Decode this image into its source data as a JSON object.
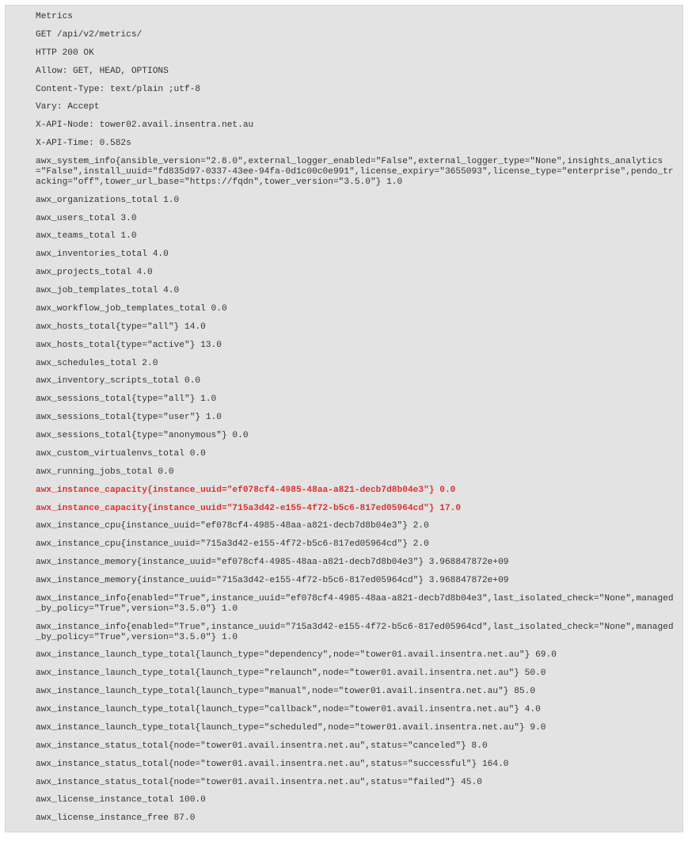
{
  "lines": [
    {
      "text": "Metrics",
      "red": false
    },
    {
      "text": "GET /api/v2/metrics/",
      "red": false
    },
    {
      "text": "HTTP 200 OK",
      "red": false
    },
    {
      "text": "Allow: GET, HEAD, OPTIONS",
      "red": false
    },
    {
      "text": "Content-Type: text/plain ;utf-8",
      "red": false
    },
    {
      "text": "Vary: Accept",
      "red": false
    },
    {
      "text": "X-API-Node: tower02.avail.insentra.net.au",
      "red": false
    },
    {
      "text": "X-API-Time: 0.582s",
      "red": false
    },
    {
      "text": "awx_system_info{ansible_version=\"2.8.0\",external_logger_enabled=\"False\",external_logger_type=\"None\",insights_analytics=\"False\",install_uuid=\"fd835d97-0337-43ee-94fa-0d1c00c0e991\",license_expiry=\"3655093\",license_type=\"enterprise\",pendo_tracking=\"off\",tower_url_base=\"https://fqdn\",tower_version=\"3.5.0\"} 1.0",
      "red": false
    },
    {
      "text": "awx_organizations_total 1.0",
      "red": false
    },
    {
      "text": "awx_users_total 3.0",
      "red": false
    },
    {
      "text": "awx_teams_total 1.0",
      "red": false
    },
    {
      "text": "awx_inventories_total 4.0",
      "red": false
    },
    {
      "text": "awx_projects_total 4.0",
      "red": false
    },
    {
      "text": "awx_job_templates_total 4.0",
      "red": false
    },
    {
      "text": "awx_workflow_job_templates_total 0.0",
      "red": false
    },
    {
      "text": "awx_hosts_total{type=\"all\"} 14.0",
      "red": false
    },
    {
      "text": "awx_hosts_total{type=\"active\"} 13.0",
      "red": false
    },
    {
      "text": "awx_schedules_total 2.0",
      "red": false
    },
    {
      "text": "awx_inventory_scripts_total 0.0",
      "red": false
    },
    {
      "text": "awx_sessions_total{type=\"all\"} 1.0",
      "red": false
    },
    {
      "text": "awx_sessions_total{type=\"user\"} 1.0",
      "red": false
    },
    {
      "text": "awx_sessions_total{type=\"anonymous\"} 0.0",
      "red": false
    },
    {
      "text": "awx_custom_virtualenvs_total 0.0",
      "red": false
    },
    {
      "text": "awx_running_jobs_total 0.0",
      "red": false
    },
    {
      "text": "awx_instance_capacity{instance_uuid=\"ef078cf4-4985-48aa-a821-decb7d8b04e3\"} 0.0",
      "red": true
    },
    {
      "text": "awx_instance_capacity{instance_uuid=\"715a3d42-e155-4f72-b5c6-817ed05964cd\"} 17.0",
      "red": true
    },
    {
      "text": "awx_instance_cpu{instance_uuid=\"ef078cf4-4985-48aa-a821-decb7d8b04e3\"} 2.0",
      "red": false
    },
    {
      "text": "awx_instance_cpu{instance_uuid=\"715a3d42-e155-4f72-b5c6-817ed05964cd\"} 2.0",
      "red": false
    },
    {
      "text": "awx_instance_memory{instance_uuid=\"ef078cf4-4985-48aa-a821-decb7d8b04e3\"} 3.968847872e+09",
      "red": false
    },
    {
      "text": "awx_instance_memory{instance_uuid=\"715a3d42-e155-4f72-b5c6-817ed05964cd\"} 3.968847872e+09",
      "red": false
    },
    {
      "text": "awx_instance_info{enabled=\"True\",instance_uuid=\"ef078cf4-4985-48aa-a821-decb7d8b04e3\",last_isolated_check=\"None\",managed_by_policy=\"True\",version=\"3.5.0\"} 1.0",
      "red": false
    },
    {
      "text": "awx_instance_info{enabled=\"True\",instance_uuid=\"715a3d42-e155-4f72-b5c6-817ed05964cd\",last_isolated_check=\"None\",managed_by_policy=\"True\",version=\"3.5.0\"} 1.0",
      "red": false
    },
    {
      "text": "awx_instance_launch_type_total{launch_type=\"dependency\",node=\"tower01.avail.insentra.net.au\"} 69.0",
      "red": false
    },
    {
      "text": "awx_instance_launch_type_total{launch_type=\"relaunch\",node=\"tower01.avail.insentra.net.au\"} 50.0",
      "red": false
    },
    {
      "text": "awx_instance_launch_type_total{launch_type=\"manual\",node=\"tower01.avail.insentra.net.au\"} 85.0",
      "red": false
    },
    {
      "text": "awx_instance_launch_type_total{launch_type=\"callback\",node=\"tower01.avail.insentra.net.au\"} 4.0",
      "red": false
    },
    {
      "text": "awx_instance_launch_type_total{launch_type=\"scheduled\",node=\"tower01.avail.insentra.net.au\"} 9.0",
      "red": false
    },
    {
      "text": "awx_instance_status_total{node=\"tower01.avail.insentra.net.au\",status=\"canceled\"} 8.0",
      "red": false
    },
    {
      "text": "awx_instance_status_total{node=\"tower01.avail.insentra.net.au\",status=\"successful\"} 164.0",
      "red": false
    },
    {
      "text": "awx_instance_status_total{node=\"tower01.avail.insentra.net.au\",status=\"failed\"} 45.0",
      "red": false
    },
    {
      "text": "awx_license_instance_total 100.0",
      "red": false
    },
    {
      "text": "awx_license_instance_free 87.0",
      "red": false
    }
  ]
}
